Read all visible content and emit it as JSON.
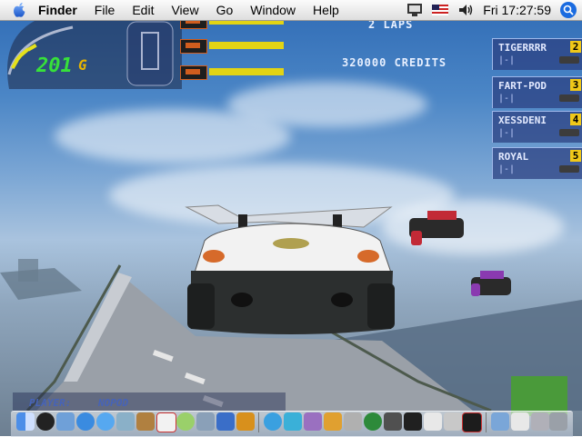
{
  "menubar": {
    "app_name": "Finder",
    "menus": [
      "File",
      "Edit",
      "View",
      "Go",
      "Window",
      "Help"
    ],
    "clock": "Fri 17:27:59"
  },
  "hud": {
    "speed": "201",
    "gear": "G",
    "laps_text": "2 LAPS",
    "credits_text": "320000 CREDITS",
    "player_label": "PLAYER:",
    "player_name": "NOPOD"
  },
  "ranking": [
    {
      "name": "TIGERRRR",
      "position": "2",
      "sub": "|-|"
    },
    {
      "name": "FART-POD",
      "position": "3",
      "sub": "|-|"
    },
    {
      "name": "XESSDENI",
      "position": "4",
      "sub": "|-|"
    },
    {
      "name": "ROYAL",
      "position": "5",
      "sub": "|-|"
    }
  ],
  "icons": {
    "apple": "apple-icon",
    "display": "display-icon",
    "flag": "us-flag-icon",
    "volume": "volume-icon",
    "spotlight": "spotlight-icon"
  },
  "colors": {
    "speed": "#37e13a",
    "gear": "#e7b400",
    "hud_text": "#e8f0ff",
    "rank_bg": "#2b3e80",
    "position_badge": "#f0c818",
    "weapon_bar": "#e2d414"
  }
}
